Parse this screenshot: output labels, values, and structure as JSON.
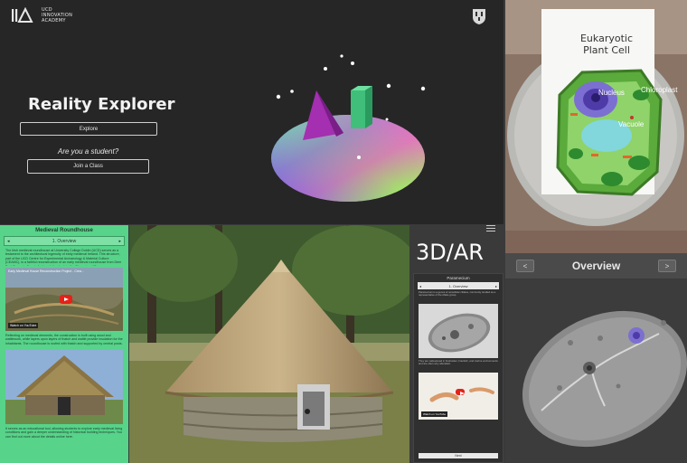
{
  "landing": {
    "logo_line1": "UCD",
    "logo_line2": "INNOVATION",
    "logo_line3": "ACADEMY",
    "title": "Reality Explorer",
    "explore_label": "Explore",
    "student_prompt": "Are you a student?",
    "join_label": "Join a Class"
  },
  "ar_panel": {
    "card_title_1": "Eukaryotic",
    "card_title_2": "Plant Cell",
    "label_nucleus": "Nucleus",
    "label_chloroplast": "Chloroplast",
    "label_vacuole": "Vacuole",
    "prev_icon": "<",
    "next_icon": ">",
    "section_title": "Overview"
  },
  "roundhouse_app": {
    "title": "Medieval Roundhouse",
    "nav_prev": "◂",
    "nav_label": "1. Overview",
    "nav_next": "▸",
    "intro_text": "The Irish medieval roundhouse at University College Dublin (UCD) serves as a testament to the architectural ingenuity of early medieval Ireland. This structure, part of the UCD Centre for Experimental Archaeology & Material Culture (CEAMC), is a faithful reconstruction of an early medieval roundhouse from Deer Park Farms in County Antrim, dating back to the 8th century AD.",
    "video_caption": "Early Medieval House Reconstruction Project - Crea...",
    "video_watch": "Watch on YouTube",
    "middle_text": "Reflecting on medieval elements, the construction is built using wood and wattlework, while layers upon layers of thatch and wattle provide insulation for the inhabitants. The roundhouse is roofed with thatch and supported by central posts.",
    "closing_text": "It serves as an educational tool, allowing students to explore early medieval living conditions and gain a deeper understanding of historical building techniques. You can find out more about the details online here."
  },
  "label_3dar": "3D/AR",
  "phone": {
    "title": "Paramecium",
    "nav_prev": "◂",
    "nav_label": "1. Overview",
    "nav_next": "▸",
    "text1": "Paramecium is a genus of unicellular ciliates, commonly studied as a representative of the ciliate group.",
    "text2": "They are widespread in freshwater, brackish, and marine environments and are often very abundant.",
    "video_watch": "Watch on YouTube",
    "footer": "Next"
  },
  "colors": {
    "app_green": "#57d38a",
    "dark_bg": "#262626",
    "youtube_red": "#e62117"
  }
}
